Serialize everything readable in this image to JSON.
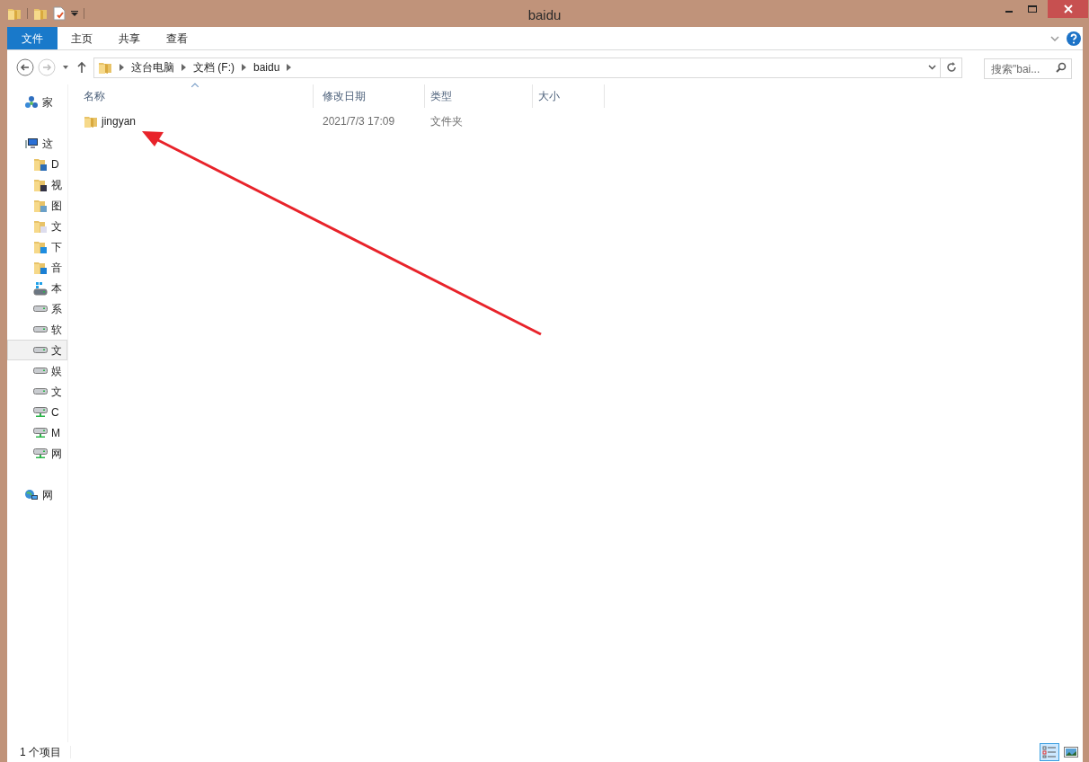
{
  "window": {
    "title": "baidu"
  },
  "ribbon_tabs": [
    {
      "label": "文件",
      "kind": "file",
      "selected": false
    },
    {
      "label": "主页",
      "kind": "tab",
      "selected": false
    },
    {
      "label": "共享",
      "kind": "tab",
      "selected": false
    },
    {
      "label": "查看",
      "kind": "tab",
      "selected": false
    }
  ],
  "address_bar": {
    "crumbs": [
      "这台电脑",
      "文档 (F:)",
      "baidu"
    ]
  },
  "search": {
    "placeholder": "搜索\"bai..."
  },
  "sidebar": {
    "items": [
      {
        "label": "家",
        "kind": "homegroup",
        "selected": false
      },
      {
        "label": "这",
        "kind": "computer",
        "selected": false,
        "children": [
          {
            "label": "D",
            "kind": "desktop",
            "selected": false
          },
          {
            "label": "视",
            "kind": "videos",
            "selected": false
          },
          {
            "label": "图",
            "kind": "pictures",
            "selected": false
          },
          {
            "label": "文",
            "kind": "documents",
            "selected": false
          },
          {
            "label": "下",
            "kind": "downloads",
            "selected": false
          },
          {
            "label": "音",
            "kind": "music",
            "selected": false
          },
          {
            "label": "本",
            "kind": "systemdrive",
            "selected": false
          },
          {
            "label": "系",
            "kind": "drive",
            "selected": false
          },
          {
            "label": "软",
            "kind": "drive",
            "selected": false
          },
          {
            "label": "文",
            "kind": "drive",
            "selected": true
          },
          {
            "label": "娱",
            "kind": "drive",
            "selected": false
          },
          {
            "label": "文",
            "kind": "drive",
            "selected": false
          },
          {
            "label": "C",
            "kind": "netdrive",
            "selected": false
          },
          {
            "label": "M",
            "kind": "netdrive",
            "selected": false
          },
          {
            "label": "网",
            "kind": "netdrive",
            "selected": false
          }
        ]
      },
      {
        "label": "网",
        "kind": "network",
        "selected": false
      }
    ]
  },
  "table": {
    "columns": [
      "名称",
      "修改日期",
      "类型",
      "大小"
    ],
    "rows": [
      {
        "name": "jingyan",
        "modified": "2021/7/3 17:09",
        "type": "文件夹",
        "selected": false
      }
    ]
  },
  "status_bar": {
    "count": "1 个项目",
    "views": [
      {
        "kind": "details",
        "selected": true
      },
      {
        "kind": "thumbnails",
        "selected": false
      }
    ]
  }
}
